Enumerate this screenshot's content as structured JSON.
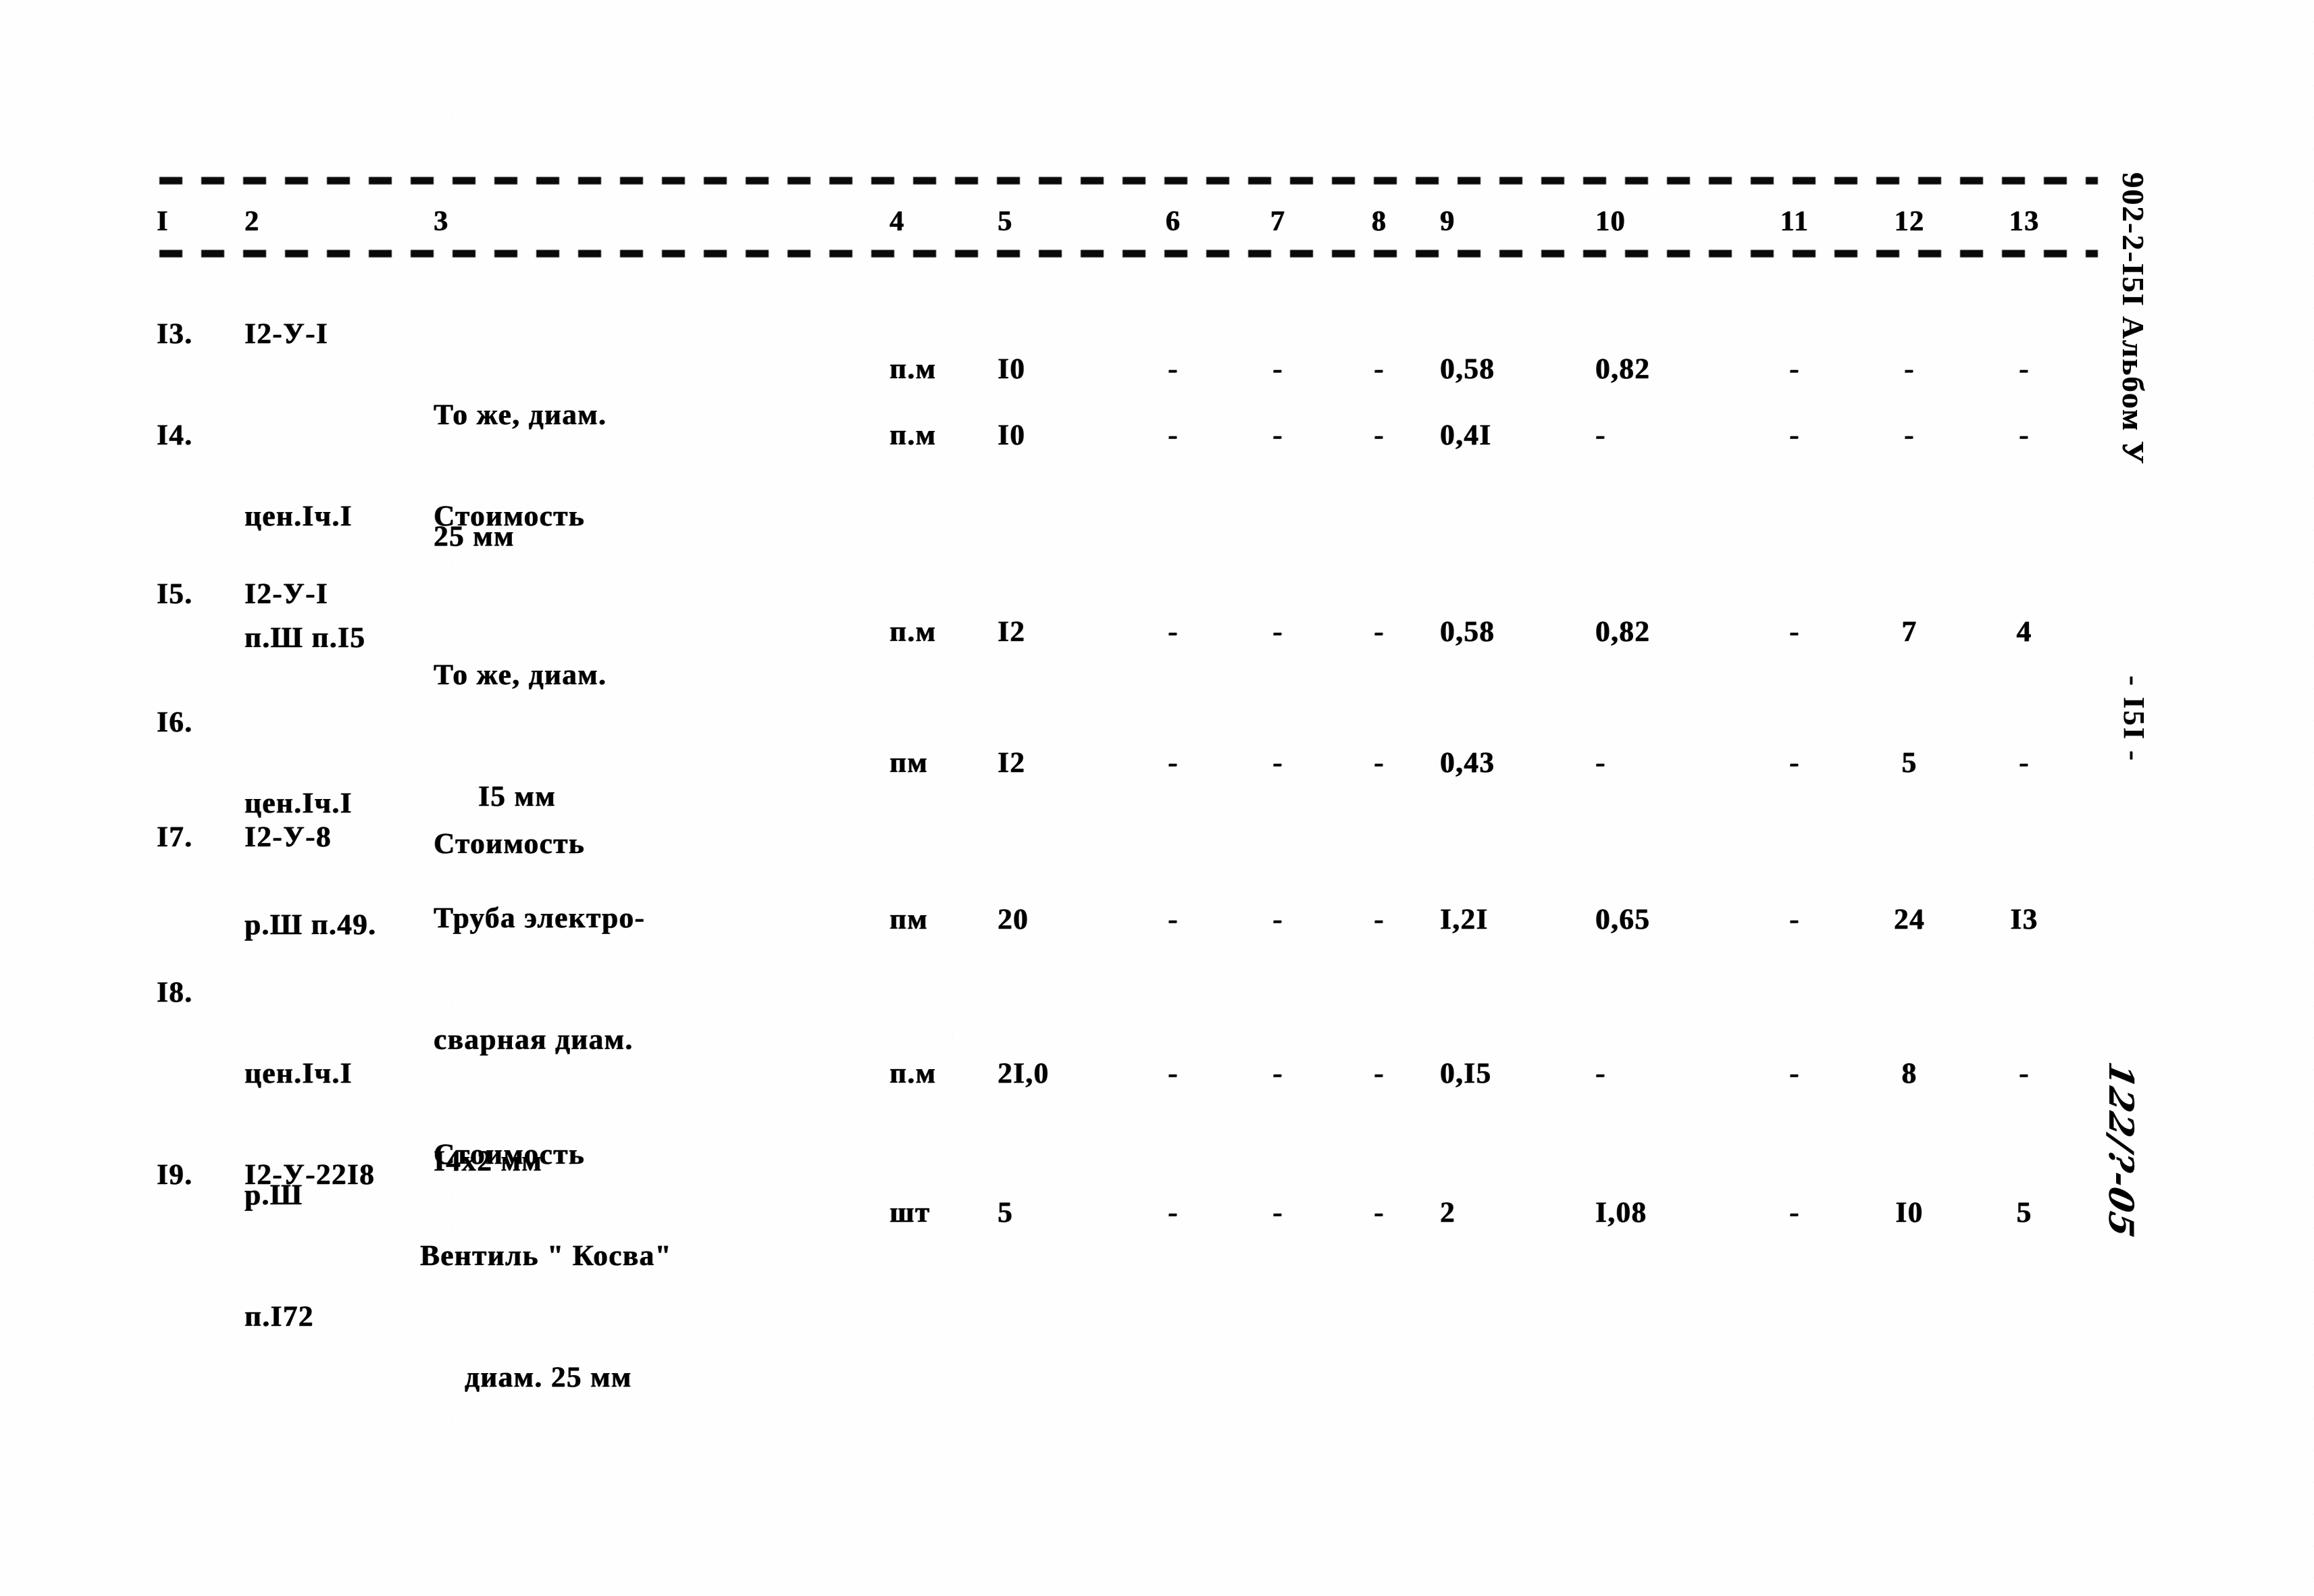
{
  "document": {
    "album_code": "902-2-I5I  Альбом У",
    "page_number": "- I5I -",
    "hand_note": "122/?-05"
  },
  "table": {
    "headers": [
      "I",
      "2",
      "3",
      "4",
      "5",
      "6",
      "7",
      "8",
      "9",
      "10",
      "11",
      "12",
      "13"
    ],
    "rows": [
      {
        "c1": "I3.",
        "c2": "I2-У-I",
        "c3_lines": [
          "То же, диам.",
          "25 мм"
        ],
        "c4": "п.м",
        "c5": "I0",
        "c6": "-",
        "c7": "-",
        "c8": "-",
        "c9": "0,58",
        "c10": "0,82",
        "c11": "-",
        "c12": "-",
        "c13": "-"
      },
      {
        "c1": "I4.",
        "c2": "цен.Iч.I",
        "c2b": "п.Ш п.I5",
        "c3_lines": [
          "Стоимость"
        ],
        "c4": "п.м",
        "c5": "I0",
        "c6": "-",
        "c7": "-",
        "c8": "-",
        "c9": "0,4I",
        "c10": "-",
        "c11": "-",
        "c12": "-",
        "c13": "-"
      },
      {
        "c1": "I5.",
        "c2": "I2-У-I",
        "c3_lines": [
          "То же, диам.",
          "I5 мм"
        ],
        "c4": "п.м",
        "c5": "I2",
        "c6": "-",
        "c7": "-",
        "c8": "-",
        "c9": "0,58",
        "c10": "0,82",
        "c11": "-",
        "c12": "7",
        "c13": "4"
      },
      {
        "c1": "I6.",
        "c2": "цен.Iч.I",
        "c2b": "р.Ш п.49.",
        "c3_lines": [
          "Стоимость"
        ],
        "c4": "пм",
        "c5": "I2",
        "c6": "-",
        "c7": "-",
        "c8": "-",
        "c9": "0,43",
        "c10": "-",
        "c11": "-",
        "c12": "5",
        "c13": "-"
      },
      {
        "c1": "I7.",
        "c2": "I2-У-8",
        "c3_lines": [
          "Труба электро-",
          "сварная диам.",
          "I4х2 мм"
        ],
        "c4": "пм",
        "c5": "20",
        "c6": "-",
        "c7": "-",
        "c8": "-",
        "c9": "I,2I",
        "c10": "0,65",
        "c11": "-",
        "c12": "24",
        "c13": "I3"
      },
      {
        "c1": "I8.",
        "c2": "цен.Iч.I",
        "c2b": "р.Ш",
        "c2c": "п.I72",
        "c3_lines": [
          "Стоимость"
        ],
        "c4": "п.м",
        "c5": "2I,0",
        "c6": "-",
        "c7": "-",
        "c8": "-",
        "c9": "0,I5",
        "c10": "-",
        "c11": "-",
        "c12": "8",
        "c13": "-"
      },
      {
        "c1": "I9.",
        "c2": "I2-У-22I8",
        "c3_lines": [
          "Вентиль \" Косва\"",
          "диам. 25 мм"
        ],
        "c4": "шт",
        "c5": "5",
        "c6": "-",
        "c7": "-",
        "c8": "-",
        "c9": "2",
        "c10": "I,08",
        "c11": "-",
        "c12": "I0",
        "c13": "5"
      }
    ]
  }
}
